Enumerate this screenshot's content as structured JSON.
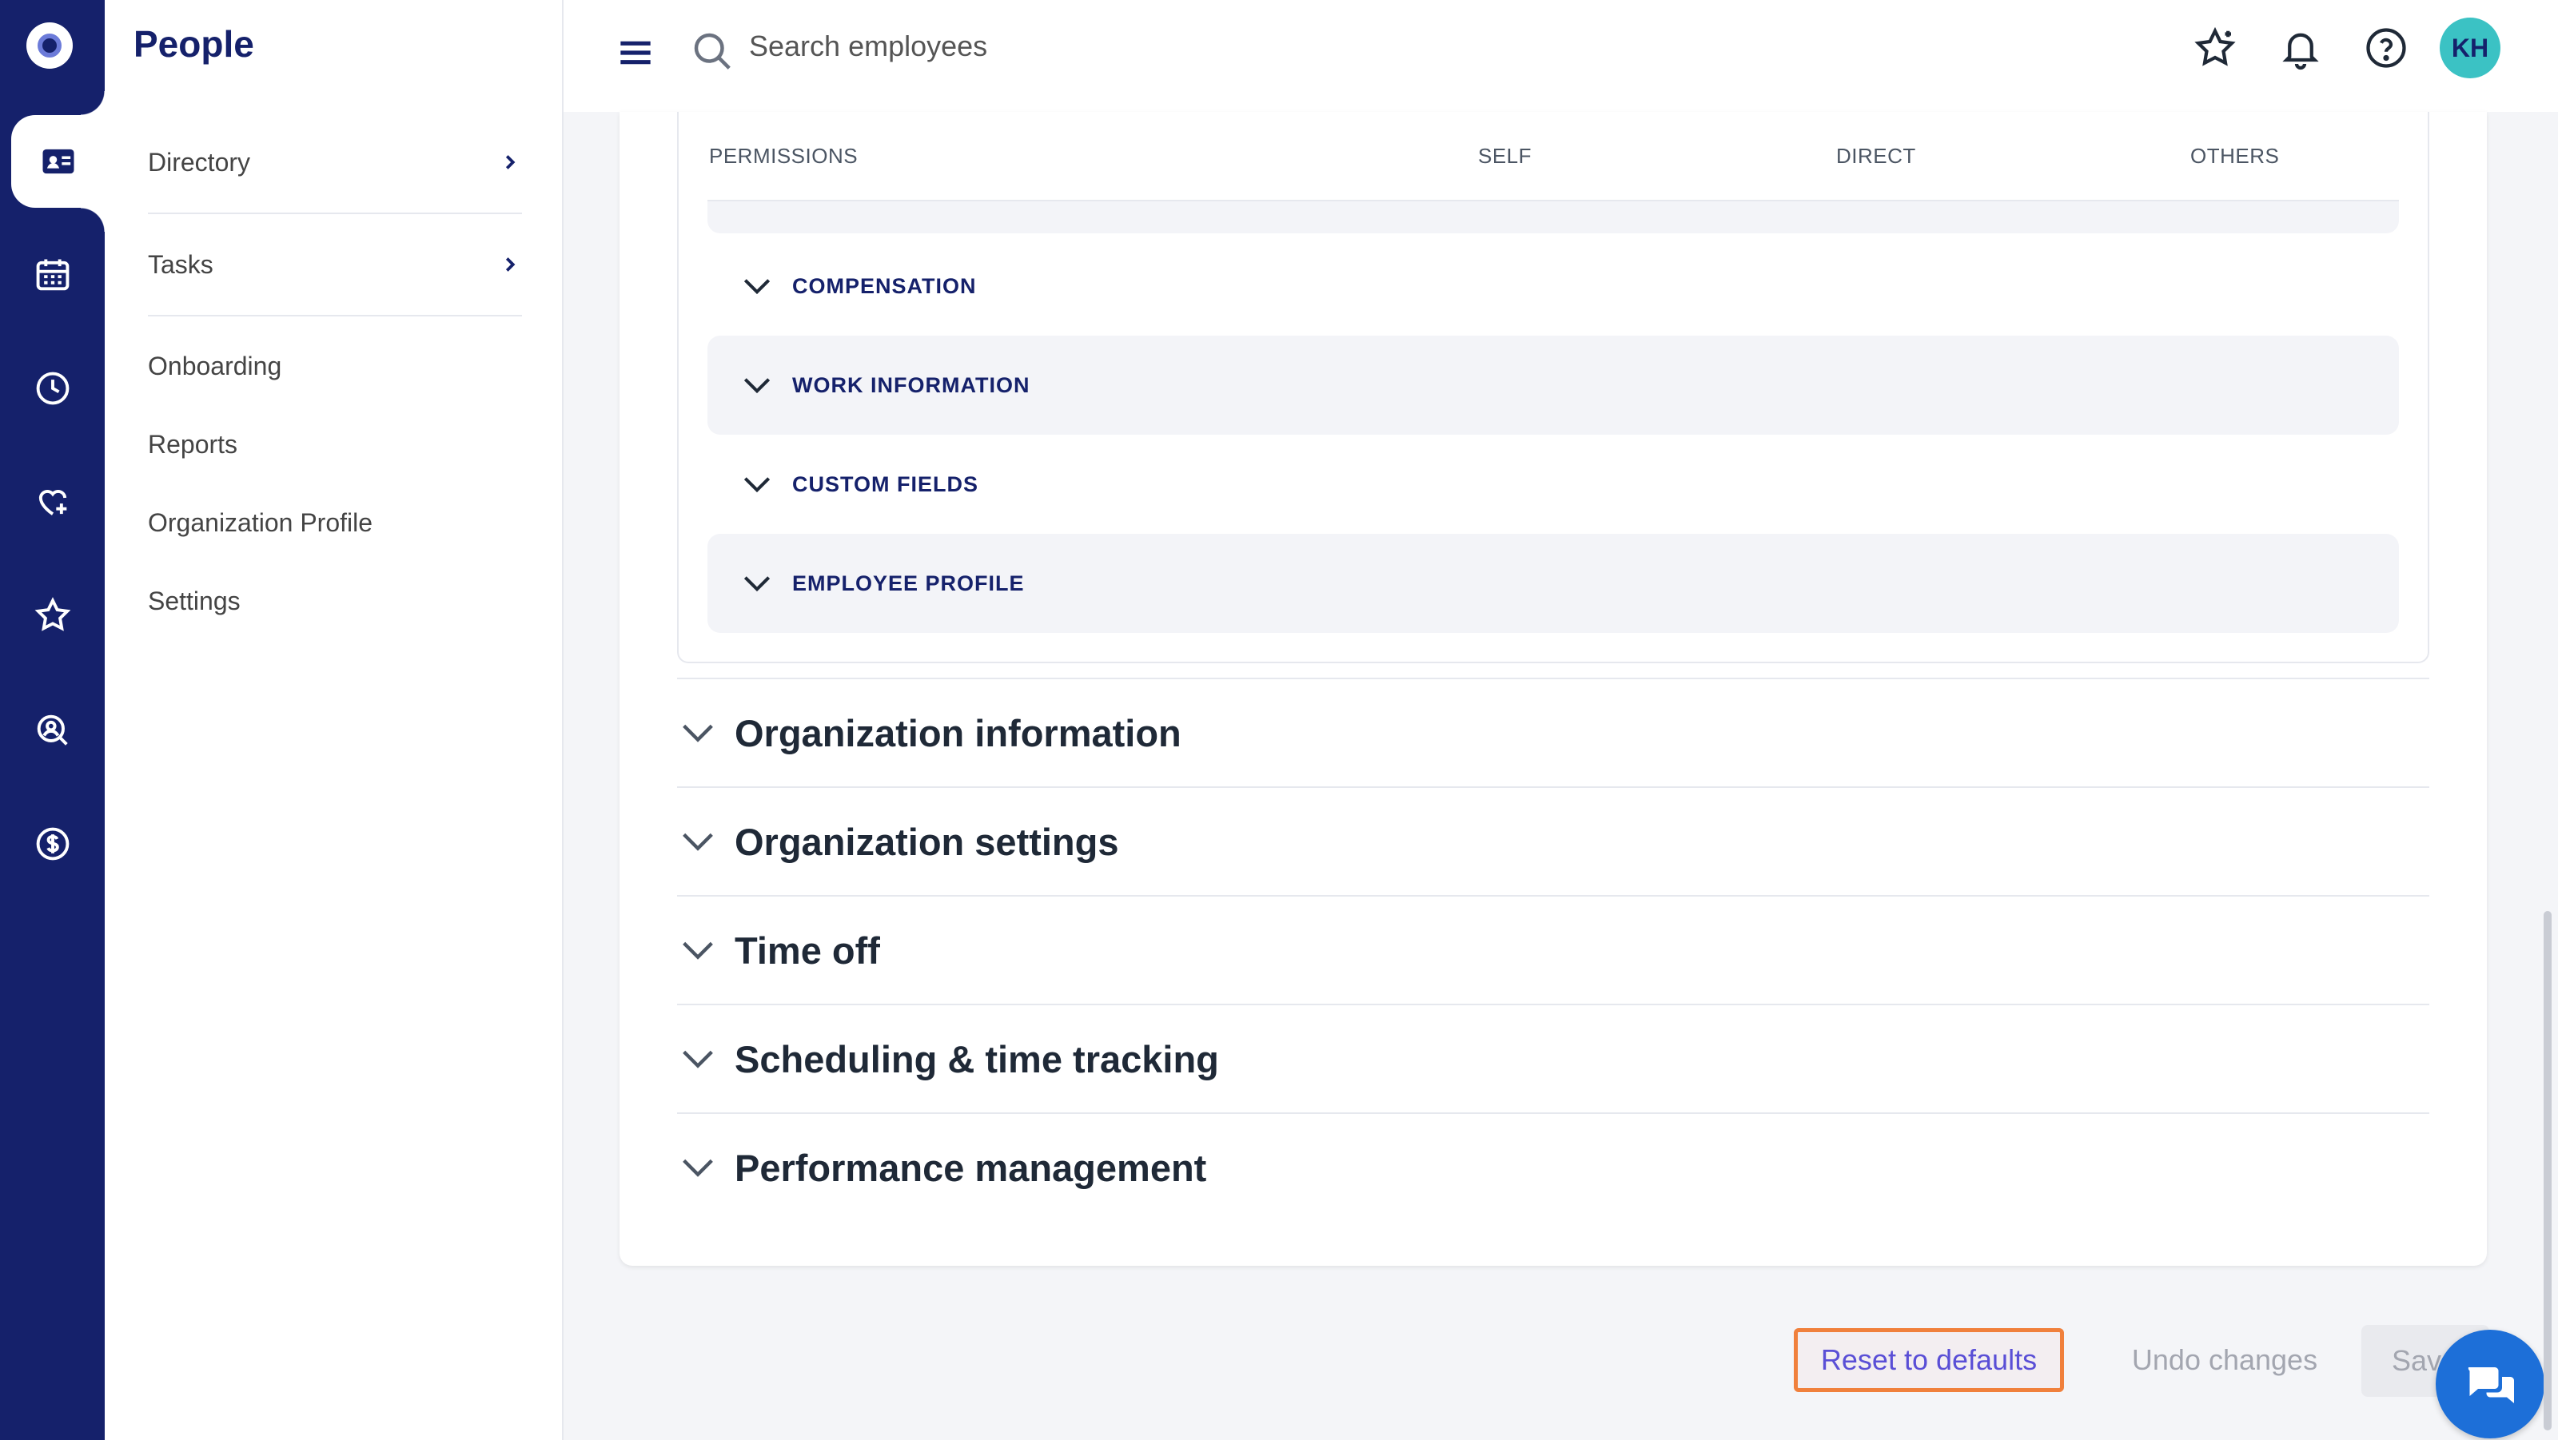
{
  "app": {
    "section_title": "People"
  },
  "rail": {
    "items": [
      {
        "icon": "logo-icon"
      },
      {
        "icon": "people-card-icon",
        "active": true
      },
      {
        "icon": "calendar-icon"
      },
      {
        "icon": "clock-icon"
      },
      {
        "icon": "heart-plus-icon"
      },
      {
        "icon": "star-icon"
      },
      {
        "icon": "person-search-icon"
      },
      {
        "icon": "dollar-icon"
      }
    ]
  },
  "subnav": {
    "title": "People",
    "items": [
      {
        "label": "Directory",
        "expandable": true
      },
      {
        "label": "Tasks",
        "expandable": true
      },
      {
        "label": "Onboarding"
      },
      {
        "label": "Reports"
      },
      {
        "label": "Organization Profile"
      },
      {
        "label": "Settings"
      }
    ]
  },
  "topbar": {
    "search_placeholder": "Search employees",
    "avatar_initials": "KH"
  },
  "permissions_table": {
    "headers": [
      "PERMISSIONS",
      "SELF",
      "DIRECT",
      "OTHERS"
    ],
    "groups": [
      "COMPENSATION",
      "WORK INFORMATION",
      "CUSTOM FIELDS",
      "EMPLOYEE PROFILE"
    ]
  },
  "sections": [
    "Organization information",
    "Organization settings",
    "Time off",
    "Scheduling & time tracking",
    "Performance management"
  ],
  "actions": {
    "reset": "Reset to defaults",
    "undo": "Undo changes",
    "save": "Save"
  },
  "colors": {
    "rail": "#15216b",
    "accent": "#5a4fd6",
    "highlight_border": "#f0803c",
    "avatar": "#3bc2c4",
    "chat": "#1d6fd8"
  }
}
